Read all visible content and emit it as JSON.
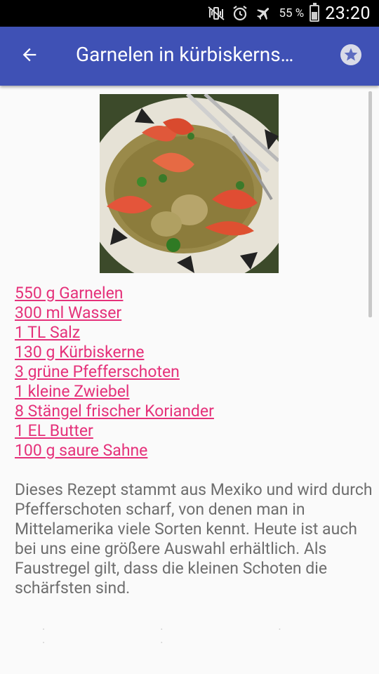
{
  "status_bar": {
    "battery_percent": "55 %",
    "battery_level": 0.55,
    "time": "23:20",
    "icons": [
      "mute-vibrate-icon",
      "alarm-icon",
      "airplane-mode-icon",
      "battery-icon"
    ]
  },
  "app_bar": {
    "title": "Garnelen in kürbiskerns…",
    "back_icon": "arrow-back-icon",
    "favorite_icon": "star-icon"
  },
  "recipe": {
    "ingredients": [
      "550 g Garnelen",
      "300 ml Wasser",
      "1 TL Salz",
      "130 g Kürbiskerne",
      "3 grüne Pfefferschoten",
      "1 kleine Zwiebel",
      "8 Stängel frischer Koriander",
      "1 EL Butter",
      "100 g saure Sahne"
    ],
    "description": "Dieses Rezept stammt aus Mexiko und wird durch Pfefferschoten scharf, von denen man in Mittelamerika viele Sorten kennt. Heute ist auch bei uns eine größere Auswahl erhältlich. Als Faustregel gilt, dass die kleinen Schoten die schärfsten sind."
  },
  "colors": {
    "app_bar": "#3f51b5",
    "ingredient_link": "#e5317a",
    "body_text": "#6e6e6e",
    "background": "#fafafa"
  }
}
